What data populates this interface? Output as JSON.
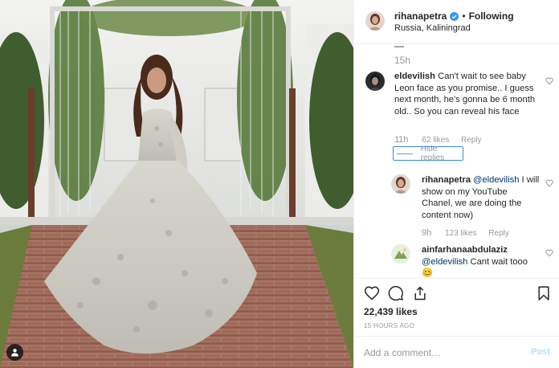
{
  "post": {
    "header": {
      "username": "rihanapetra",
      "separator": "•",
      "follow_label": "Following",
      "location": "Russia, Kaliningrad"
    },
    "comments_area": {
      "partial_text": "—",
      "top_time": "15h",
      "comments": [
        {
          "username": "eldevilish",
          "text": "Can't wait to see baby Leon face as you promise.. I guess next month, he's gonna be 6 month old.. So you can reveal his face",
          "time": "11h",
          "likes": "62 likes",
          "reply_label": "Reply"
        }
      ],
      "hide_replies_label": "Hide replies",
      "replies": [
        {
          "username": "rihanapetra",
          "mention": "@eldevilish",
          "text": "I will show on my YouTube Chanel, we are doing the content now)",
          "time": "9h",
          "likes": "123 likes",
          "reply_label": "Reply"
        },
        {
          "username": "ainfarhanaabdulaziz",
          "mention": "@eldevilish",
          "text": "Cant wait tooo",
          "emoji": "😊"
        }
      ]
    },
    "likes_count": "22,439 likes",
    "time_ago": "15 HOURS AGO",
    "add_comment": {
      "placeholder": "Add a comment…",
      "post_label": "Post"
    },
    "icons": {
      "like": "heart-icon",
      "comment": "comment-bubble-icon",
      "share": "share-icon",
      "save": "bookmark-icon",
      "user_tags": "user-tag-icon",
      "verified": "verified-badge-icon"
    },
    "colors": {
      "link": "#003569",
      "muted": "#999999",
      "verified": "#3897f0",
      "post_disabled": "#b2dffc"
    }
  }
}
